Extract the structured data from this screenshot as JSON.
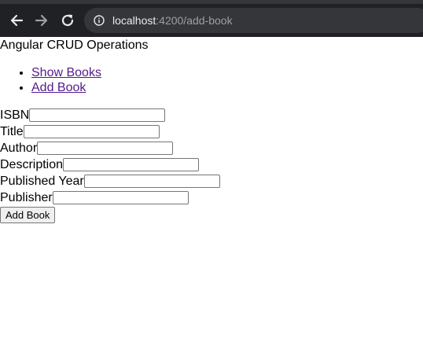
{
  "browser": {
    "url_host": "localhost",
    "url_path": ":4200/add-book"
  },
  "app": {
    "title": "Angular CRUD Operations",
    "nav": [
      "Show Books",
      "Add Book"
    ]
  },
  "form": {
    "fields": {
      "isbn": "ISBN",
      "title": "Title",
      "author": "Author",
      "description": "Description",
      "published_year": "Published Year",
      "publisher": "Publisher"
    },
    "submit_label": "Add Book"
  }
}
